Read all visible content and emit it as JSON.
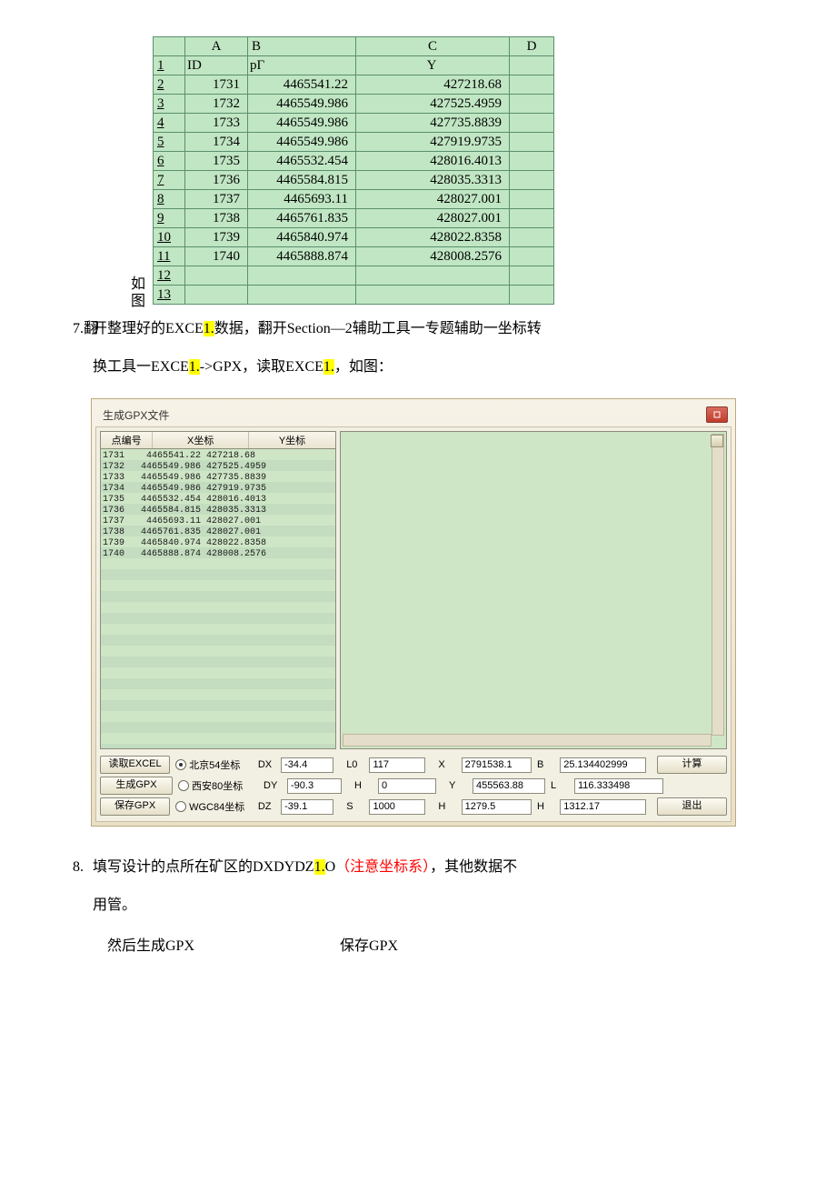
{
  "text": {
    "ruotu_l1": "如",
    "ruotu_l2": "图",
    "p7_num": "7.翻",
    "p7_a": "开整理好的EXCE",
    "p7_hl1": "1.",
    "p7_b": "数据，翻开Section—2辅助工具一专题辅助一坐标转",
    "p7_c": "换工具一EXCE",
    "p7_hl2": "1.",
    "p7_d": "->GPX，读取EXCE",
    "p7_hl3": "1.",
    "p7_e": "，如图：",
    "p8_num": "8.",
    "p8_a": "填写设计的点所在矿区的DXDYDZ",
    "p8_hl": "1.",
    "p8_b": "O",
    "p8_red": "（注意坐标系）",
    "p8_c": "，其他数据不",
    "p8_d": "用管。",
    "bottom_a": "然后生成GPX",
    "bottom_b": "保存GPX"
  },
  "excel": {
    "cols": [
      "A",
      "B",
      "C",
      "D"
    ],
    "r1": {
      "num": "1",
      "A": "ID",
      "B": "pΓ",
      "C": "Y",
      "D": ""
    },
    "rows": [
      {
        "num": "2",
        "A": "1731",
        "B": "4465541.22",
        "C": "427218.68"
      },
      {
        "num": "3",
        "A": "1732",
        "B": "4465549.986",
        "C": "427525.4959"
      },
      {
        "num": "4",
        "A": "1733",
        "B": "4465549.986",
        "C": "427735.8839"
      },
      {
        "num": "5",
        "A": "1734",
        "B": "4465549.986",
        "C": "427919.9735"
      },
      {
        "num": "6",
        "A": "1735",
        "B": "4465532.454",
        "C": "428016.4013"
      },
      {
        "num": "7",
        "A": "1736",
        "B": "4465584.815",
        "C": "428035.3313"
      },
      {
        "num": "8",
        "A": "1737",
        "B": "4465693.11",
        "C": "428027.001"
      },
      {
        "num": "9",
        "A": "1738",
        "B": "4465761.835",
        "C": "428027.001"
      },
      {
        "num": "10",
        "A": "1739",
        "B": "4465840.974",
        "C": "428022.8358"
      },
      {
        "num": "11",
        "A": "1740",
        "B": "4465888.874",
        "C": "428008.2576"
      }
    ],
    "empty_rows": [
      "12",
      "13"
    ]
  },
  "dialog": {
    "title": "生成GPX文件",
    "col_head": {
      "id": "点编号",
      "x": "X坐标",
      "y": "Y坐标"
    },
    "buttons": {
      "read": "读取EXCEL",
      "gen": "生成GPX",
      "save": "保存GPX",
      "calc": "计算",
      "exit": "退出"
    },
    "radios": {
      "bj": "北京54坐标",
      "xa": "西安80坐标",
      "wgc": "WGC84坐标"
    },
    "labels": {
      "DX": "DX",
      "DY": "DY",
      "DZ": "DZ",
      "L0": "L0",
      "H": "H",
      "S": "S",
      "X": "X",
      "Y": "Y",
      "H2": "H",
      "B": "B",
      "L": "L",
      "H3": "H"
    },
    "values": {
      "DX": "-34.4",
      "DY": "-90.3",
      "DZ": "-39.1",
      "L0": "117",
      "H": "0",
      "S": "1000",
      "X": "2791538.1",
      "Y": "455563.88",
      "H2": "1279.5",
      "B": "25.134402999",
      "L": "116.333498",
      "H3": "1312.17"
    },
    "list": [
      {
        "id": "1731",
        "x": "4465541.22",
        "y": "427218.68"
      },
      {
        "id": "1732",
        "x": "4465549.986",
        "y": "427525.4959"
      },
      {
        "id": "1733",
        "x": "4465549.986",
        "y": "427735.8839"
      },
      {
        "id": "1734",
        "x": "4465549.986",
        "y": "427919.9735"
      },
      {
        "id": "1735",
        "x": "4465532.454",
        "y": "428016.4013"
      },
      {
        "id": "1736",
        "x": "4465584.815",
        "y": "428035.3313"
      },
      {
        "id": "1737",
        "x": "4465693.11",
        "y": "428027.001"
      },
      {
        "id": "1738",
        "x": "4465761.835",
        "y": "428027.001"
      },
      {
        "id": "1739",
        "x": "4465840.974",
        "y": "428022.8358"
      },
      {
        "id": "1740",
        "x": "4465888.874",
        "y": "428008.2576"
      }
    ]
  }
}
